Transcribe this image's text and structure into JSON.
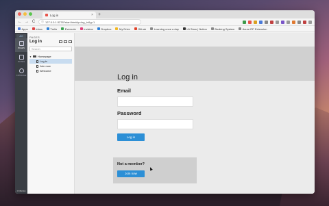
{
  "browser": {
    "tab_title": "Log in",
    "new_tab": "+",
    "close": "×",
    "url": "127.0.0.1:3278?start.html#p=log_in&g=1",
    "nav": {
      "back": "←",
      "forward": "→",
      "reload": "C"
    },
    "ext_colors": [
      "#3c9a4a",
      "#e8534a",
      "#d9a020",
      "#4a7ad9",
      "#888",
      "#c04040",
      "#999",
      "#7a55c8",
      "#999",
      "#e07a30",
      "#888",
      "#c04040",
      "#999"
    ],
    "traffic_colors": [
      "#ee5f57",
      "#f5be3f",
      "#5ac64e"
    ]
  },
  "bookmarks": [
    {
      "label": "Apps",
      "color": "#4a7ad9"
    },
    {
      "label": "Inbox",
      "color": "#d44"
    },
    {
      "label": "Trello",
      "color": "#2d7fd6"
    },
    {
      "label": "Evernote",
      "color": "#3aa450"
    },
    {
      "label": "Invision",
      "color": "#e0407a"
    },
    {
      "label": "Dropbox",
      "color": "#2d7fd6"
    },
    {
      "label": "My Drive",
      "color": "#f2b820"
    },
    {
      "label": "GitLab",
      "color": "#e2432a"
    },
    {
      "label": "Learning once a day",
      "color": "#888"
    },
    {
      "label": "UX Now | Notion",
      "color": "#333"
    },
    {
      "label": "Booking System",
      "color": "#888"
    },
    {
      "label": "Axure RP Extension",
      "color": "#888"
    }
  ],
  "rail": {
    "logo": "AX",
    "items": [
      {
        "label": "PAGES"
      },
      {
        "label": "NOTES"
      },
      {
        "label": "CONSOLE"
      }
    ],
    "publish": "PUBLISH"
  },
  "panel": {
    "section_label": "PAGES",
    "title": "Log in",
    "search_placeholder": "Search",
    "tree": [
      {
        "label": "Homepage",
        "type": "folder"
      },
      {
        "label": "Log in",
        "type": "page"
      },
      {
        "label": "Join now",
        "type": "page"
      },
      {
        "label": "Welcome",
        "type": "page"
      }
    ]
  },
  "page": {
    "heading": "Log in",
    "email_label": "Email",
    "password_label": "Password",
    "login_button": "Log in",
    "member_prompt": "Not a member?",
    "join_button": "Join now"
  }
}
